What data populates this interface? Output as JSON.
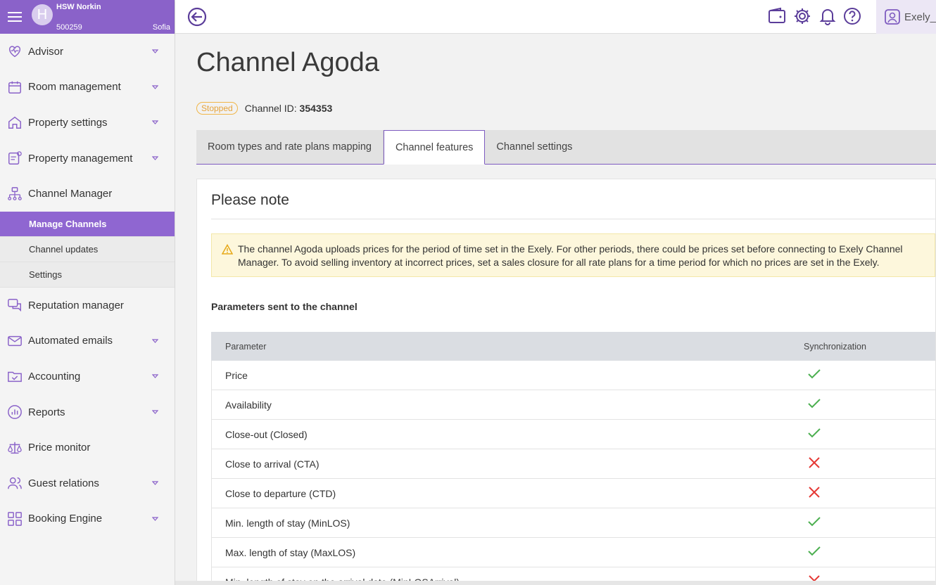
{
  "property": {
    "name": "HSW Norkin",
    "id": "500259",
    "city": "Sofia",
    "avatar_letter": "H"
  },
  "nav": {
    "items": [
      {
        "label": "Advisor",
        "icon": "heart-pulse-icon",
        "caret": true
      },
      {
        "label": "Room management",
        "icon": "calendar-icon",
        "caret": true
      },
      {
        "label": "Property settings",
        "icon": "home-icon",
        "caret": true
      },
      {
        "label": "Property management",
        "icon": "document-user-icon",
        "caret": true
      },
      {
        "label": "Channel Manager",
        "icon": "sitemap-icon",
        "caret": false
      },
      {
        "label": "Reputation manager",
        "icon": "chat-bubbles-icon",
        "caret": false
      },
      {
        "label": "Automated emails",
        "icon": "envelope-icon",
        "caret": true
      },
      {
        "label": "Accounting",
        "icon": "folder-check-icon",
        "caret": true
      },
      {
        "label": "Reports",
        "icon": "bar-chart-circle-icon",
        "caret": true
      },
      {
        "label": "Price monitor",
        "icon": "scales-icon",
        "caret": false
      },
      {
        "label": "Guest relations",
        "icon": "users-icon",
        "caret": true
      },
      {
        "label": "Booking Engine",
        "icon": "grid-icon",
        "caret": true
      }
    ],
    "channel_sub": [
      {
        "label": "Manage Channels",
        "active": true
      },
      {
        "label": "Channel updates",
        "active": false
      },
      {
        "label": "Settings",
        "active": false
      }
    ]
  },
  "topbar": {
    "user_label": "Exely_"
  },
  "page": {
    "title": "Channel Agoda",
    "status": "Stopped",
    "channel_id_label": "Channel ID:",
    "channel_id": "354353"
  },
  "tabs": [
    {
      "label": "Room types and rate plans mapping",
      "active": false
    },
    {
      "label": "Channel features",
      "active": true
    },
    {
      "label": "Channel settings",
      "active": false
    }
  ],
  "note": {
    "title": "Please note",
    "warning": "The channel Agoda uploads prices for the period of time set in the Exely. For other periods, there could be prices set before connecting to Exely Channel Manager. To avoid selling inventory at incorrect prices, set a sales closure for all rate plans for a time period for which no prices are set in the Exely."
  },
  "params": {
    "section_title": "Parameters sent to the channel",
    "col_parameter": "Parameter",
    "col_sync": "Synchronization",
    "rows": [
      {
        "name": "Price",
        "sync": true
      },
      {
        "name": "Availability",
        "sync": true
      },
      {
        "name": "Close-out (Closed)",
        "sync": true
      },
      {
        "name": "Close to arrival (CTA)",
        "sync": false
      },
      {
        "name": "Close to departure (CTD)",
        "sync": false
      },
      {
        "name": "Min. length of stay (MinLOS)",
        "sync": true
      },
      {
        "name": "Max. length of stay (MaxLOS)",
        "sync": true
      },
      {
        "name": "Min. length of stay on the arrival date (MinLOSArrival)",
        "sync": false
      }
    ]
  },
  "colors": {
    "accent": "#8a62c9",
    "check": "#4caf50",
    "cross": "#e53935",
    "warning": "#f0b648"
  }
}
